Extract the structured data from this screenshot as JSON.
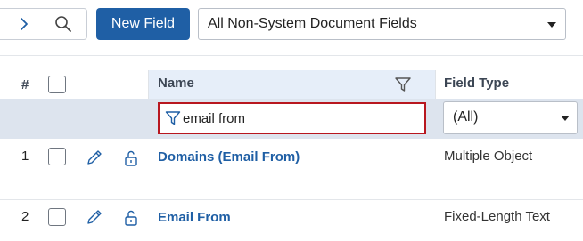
{
  "toolbar": {
    "new_field_label": "New Field",
    "view_selected": "All Non-System Document Fields",
    "icons": [
      "chevron-right-icon",
      "search-icon"
    ]
  },
  "grid": {
    "columns": {
      "number": "#",
      "name": "Name",
      "field_type": "Field Type"
    },
    "filters": {
      "name_value": "email from",
      "field_type_value": "(All)"
    },
    "rows": [
      {
        "num": "1",
        "name": "Domains (Email From)",
        "field_type": "Multiple Object"
      },
      {
        "num": "2",
        "name": "Email From",
        "field_type": "Fixed-Length Text"
      }
    ]
  },
  "colors": {
    "primary": "#1f5fa5",
    "filter_highlight_border": "#b8171f",
    "filter_row_bg": "#dde4ee",
    "name_header_bg": "#e6eef9"
  }
}
